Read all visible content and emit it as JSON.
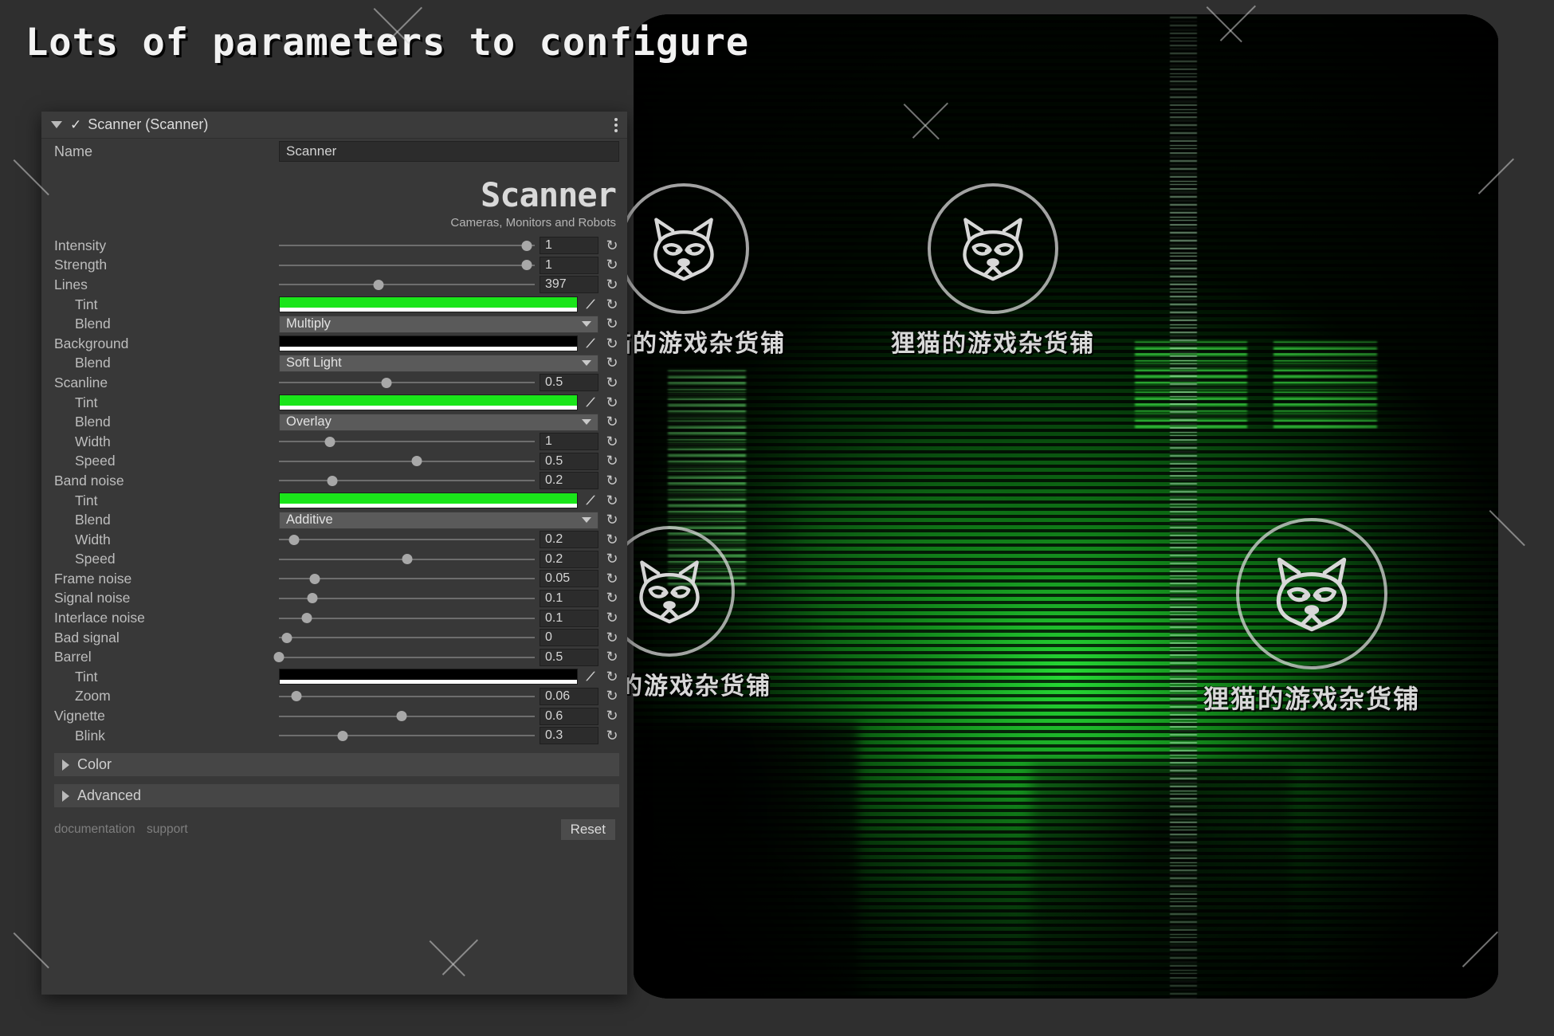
{
  "headline": "Lots of parameters to configure",
  "watermark": {
    "text": "狸猫的游戏杂货铺",
    "icon": "raccoon-icon"
  },
  "panel": {
    "title": "Scanner (Scanner)",
    "enabled_checkmark": "✓",
    "kebab": "kebab-menu",
    "name_label": "Name",
    "name_value": "Scanner",
    "brand_title": "Scanner",
    "brand_subtitle": "Cameras, Monitors and Robots",
    "reset_icon": "↻",
    "eyedropper_icon": "eyedropper",
    "rows": [
      {
        "label": "Intensity",
        "indent": 0,
        "type": "slider",
        "value": "1",
        "knob": 97
      },
      {
        "label": "Strength",
        "indent": 0,
        "type": "slider",
        "value": "1",
        "knob": 97
      },
      {
        "label": "Lines",
        "indent": 0,
        "type": "slider",
        "value": "397",
        "knob": 39
      },
      {
        "label": "Tint",
        "indent": 1,
        "type": "color",
        "value": "#1ae51a"
      },
      {
        "label": "Blend",
        "indent": 1,
        "type": "dropdown",
        "value": "Multiply"
      },
      {
        "label": "Background",
        "indent": 0,
        "type": "color",
        "value": "#000000"
      },
      {
        "label": "Blend",
        "indent": 1,
        "type": "dropdown",
        "value": "Soft Light"
      },
      {
        "label": "Scanline",
        "indent": 0,
        "type": "slider",
        "value": "0.5",
        "knob": 42
      },
      {
        "label": "Tint",
        "indent": 1,
        "type": "color",
        "value": "#1ae51a"
      },
      {
        "label": "Blend",
        "indent": 1,
        "type": "dropdown",
        "value": "Overlay"
      },
      {
        "label": "Width",
        "indent": 1,
        "type": "slider",
        "value": "1",
        "knob": 20
      },
      {
        "label": "Speed",
        "indent": 1,
        "type": "slider",
        "value": "0.5",
        "knob": 54
      },
      {
        "label": "Band noise",
        "indent": 0,
        "type": "slider",
        "value": "0.2",
        "knob": 21
      },
      {
        "label": "Tint",
        "indent": 1,
        "type": "color",
        "value": "#1ae51a"
      },
      {
        "label": "Blend",
        "indent": 1,
        "type": "dropdown",
        "value": "Additive"
      },
      {
        "label": "Width",
        "indent": 1,
        "type": "slider",
        "value": "0.2",
        "knob": 6
      },
      {
        "label": "Speed",
        "indent": 1,
        "type": "slider",
        "value": "0.2",
        "knob": 50
      },
      {
        "label": "Frame noise",
        "indent": 0,
        "type": "slider",
        "value": "0.05",
        "knob": 14
      },
      {
        "label": "Signal noise",
        "indent": 0,
        "type": "slider",
        "value": "0.1",
        "knob": 13
      },
      {
        "label": "Interlace noise",
        "indent": 0,
        "type": "slider",
        "value": "0.1",
        "knob": 11
      },
      {
        "label": "Bad signal",
        "indent": 0,
        "type": "slider",
        "value": "0",
        "knob": 3
      },
      {
        "label": "Barrel",
        "indent": 0,
        "type": "slider",
        "value": "0.5",
        "knob": 0
      },
      {
        "label": "Tint",
        "indent": 1,
        "type": "color",
        "value": "#000000"
      },
      {
        "label": "Zoom",
        "indent": 1,
        "type": "slider",
        "value": "0.06",
        "knob": 7
      },
      {
        "label": "Vignette",
        "indent": 0,
        "type": "slider",
        "value": "0.6",
        "knob": 48
      },
      {
        "label": "Blink",
        "indent": 1,
        "type": "slider",
        "value": "0.3",
        "knob": 25
      }
    ],
    "foldouts": [
      {
        "label": "Color"
      },
      {
        "label": "Advanced"
      }
    ],
    "footer": {
      "documentation": "documentation",
      "support": "support",
      "reset_button": "Reset"
    }
  },
  "colors": {
    "accent_green": "#1ae51a",
    "panel_bg": "#383838",
    "crt_green": "#1fb828"
  }
}
